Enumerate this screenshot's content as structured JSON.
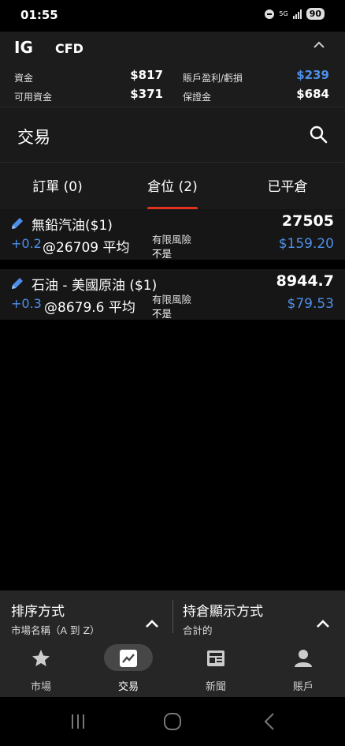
{
  "status_bar": {
    "time": "01:55",
    "network": "5G",
    "battery": "90"
  },
  "account": {
    "brand": "IG",
    "type": "CFD",
    "funds_label": "資金",
    "funds_value": "$817",
    "available_label": "可用資金",
    "available_value": "$371",
    "pl_label": "賬戶盈利/虧損",
    "pl_value": "$239",
    "margin_label": "保證金",
    "margin_value": "$684"
  },
  "header": {
    "title": "交易"
  },
  "tabs": [
    {
      "label": "訂單 (0)"
    },
    {
      "label": "倉位 (2)",
      "active": true
    },
    {
      "label": "已平倉"
    }
  ],
  "positions": [
    {
      "name": "無鉛汽油($1)",
      "size": "+0.2",
      "open_level": "@26709 平均",
      "risk_label": "有限風險",
      "risk_value": "不是",
      "price": "27505",
      "pl": "$159.20"
    },
    {
      "name": "石油 - 美國原油 ($1)",
      "size": "+0.3",
      "open_level": "@8679.6 平均",
      "risk_label": "有限風險",
      "risk_value": "不是",
      "price": "8944.7",
      "pl": "$79.53"
    }
  ],
  "sort_panel": {
    "sort_title": "排序方式",
    "sort_value": "市場名稱（A 到 Z）",
    "display_title": "持倉顯示方式",
    "display_value": "合計的"
  },
  "bottom_nav": [
    {
      "label": "市場",
      "icon": "star-icon"
    },
    {
      "label": "交易",
      "icon": "chart-icon",
      "active": true
    },
    {
      "label": "新聞",
      "icon": "newspaper-icon"
    },
    {
      "label": "賬戶",
      "icon": "person-icon"
    }
  ],
  "colors": {
    "accent_blue": "#4d8fe8",
    "tab_underline": "#e0321e",
    "background": "#000000"
  }
}
